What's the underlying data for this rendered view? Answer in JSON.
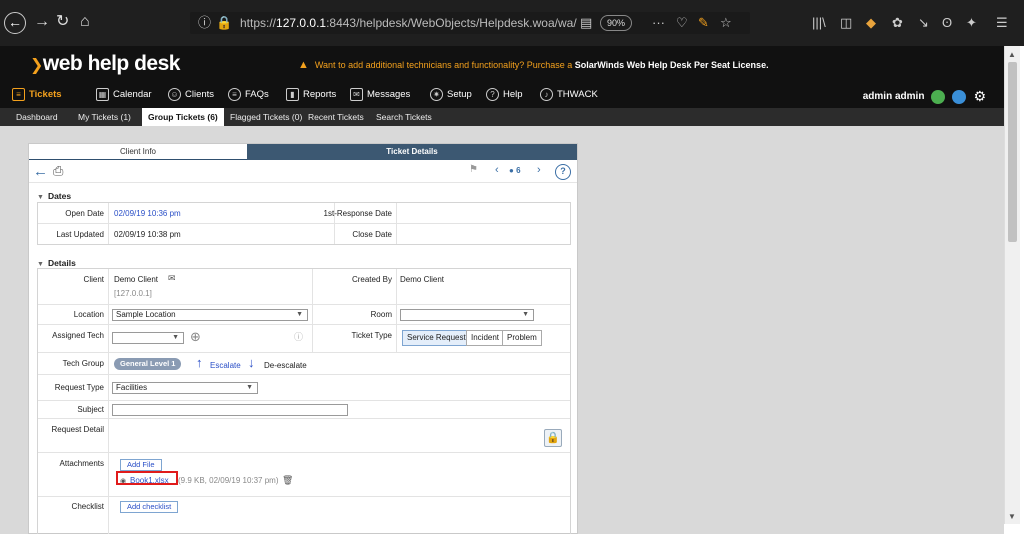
{
  "browser": {
    "url_prefix": "https://",
    "url_host": "127.0.0.1",
    "url_rest": ":8443/helpdesk/WebObjects/Helpdesk.woa/wa/",
    "zoom": "90%",
    "more": "···"
  },
  "header": {
    "logo": "web help desk",
    "warning": "Want to add additional technicians and functionality? Purchase a",
    "warning_bold": "SolarWinds Web Help Desk Per Seat License."
  },
  "menu": {
    "items": [
      "Tickets",
      "Calendar",
      "Clients",
      "FAQs",
      "Reports",
      "Messages",
      "Setup",
      "Help",
      "THWACK"
    ],
    "user": "admin admin"
  },
  "subnav": [
    "Dashboard",
    "My Tickets (1)",
    "Group Tickets (6)",
    "Flagged Tickets (0)",
    "Recent Tickets",
    "Search Tickets"
  ],
  "tabs": {
    "client_info": "Client Info",
    "ticket_details": "Ticket Details"
  },
  "toolbar": {
    "ticket_count": "6"
  },
  "dates": {
    "heading": "Dates",
    "open_date_label": "Open Date",
    "open_date": "02/09/19 10:36 pm",
    "first_response_label": "1st-Response Date",
    "last_updated_label": "Last Updated",
    "last_updated": "02/09/19 10:38 pm",
    "close_date_label": "Close Date"
  },
  "details": {
    "heading": "Details",
    "client_label": "Client",
    "client": "Demo Client",
    "client_ip": "[127.0.0.1]",
    "created_by_label": "Created By",
    "created_by": "Demo Client",
    "location_label": "Location",
    "location": "Sample Location",
    "room_label": "Room",
    "assigned_tech_label": "Assigned Tech",
    "ticket_type_label": "Ticket Type",
    "ticket_types": [
      "Service Request",
      "Incident",
      "Problem"
    ],
    "tech_group_label": "Tech Group",
    "tech_group": "General Level 1",
    "escalate": "Escalate",
    "deescalate": "De-escalate",
    "request_type_label": "Request Type",
    "request_type": "Facilities",
    "subject_label": "Subject",
    "request_detail_label": "Request Detail",
    "attachments_label": "Attachments",
    "add_file": "Add File",
    "attachment_name": "Book1.xlsx",
    "attachment_meta": "(9.9 KB, 02/09/19 10:37 pm)",
    "checklist_label": "Checklist",
    "add_checklist": "Add checklist"
  }
}
